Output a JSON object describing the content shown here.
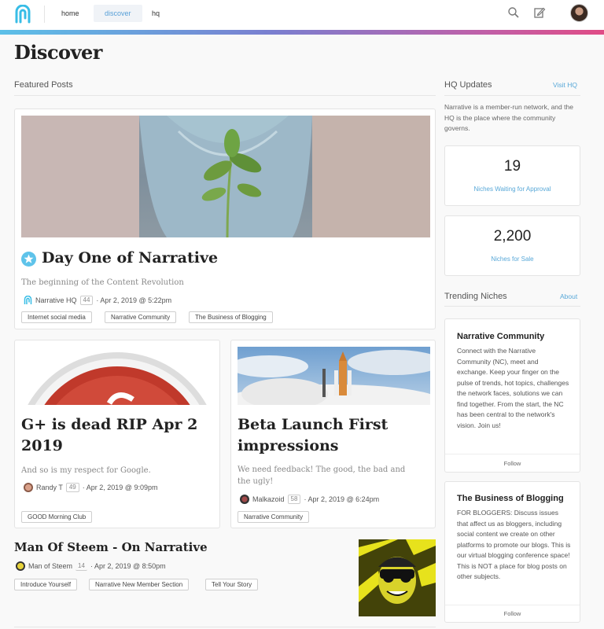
{
  "nav": {
    "home": "home",
    "discover": "discover",
    "hq": "hq"
  },
  "page": {
    "title": "Discover"
  },
  "featured": {
    "label": "Featured Posts",
    "main": {
      "title": "Day One of Narrative",
      "subtitle": "The beginning of the Content Revolution",
      "author": "Narrative HQ",
      "rep": "44",
      "date": "· Apr 2, 2019 @ 5:22pm",
      "tags": [
        "Internet social media",
        "Narrative Community",
        "The Business of Blogging"
      ]
    },
    "left": {
      "title": "G+ is dead RIP Apr 2 2019",
      "subtitle": "And so is my respect for Google.",
      "author": "Randy T",
      "rep": "49",
      "date": "· Apr 2, 2019 @ 9:09pm",
      "tags": [
        "GOOD Morning Club"
      ]
    },
    "right": {
      "title": "Beta Launch First impressions",
      "subtitle": "We need feedback! The good, the bad and the ugly!",
      "author": "Malkazoid",
      "rep": "58",
      "date": "· Apr 2, 2019 @ 6:24pm",
      "tags": [
        "Narrative Community"
      ]
    }
  },
  "list_post": {
    "title": "Man Of Steem - On Narrative",
    "author": "Man of Steem",
    "rep": "14",
    "date": "· Apr 2, 2019 @ 8:50pm",
    "tags": [
      "Introduce Yourself",
      "Narrative New Member Section",
      "Tell Your Story"
    ]
  },
  "hq": {
    "label": "HQ Updates",
    "link": "Visit HQ",
    "desc": "Narrative is a member-run network, and the HQ is the place where the community governs.",
    "stats": [
      {
        "value": "19",
        "label": "Niches Waiting for Approval"
      },
      {
        "value": "2,200",
        "label": "Niches for Sale"
      }
    ]
  },
  "trending": {
    "label": "Trending Niches",
    "link": "About",
    "niches": [
      {
        "title": "Narrative Community",
        "desc": "Connect with the Narrative Community (NC), meet and exchange. Keep your finger on the pulse of trends, hot topics, challenges the network faces, solutions we can find together. From the start, the NC has been central to the network's vision. Join us!",
        "follow": "Follow"
      },
      {
        "title": "The Business of Blogging",
        "desc": "FOR BLOGGERS: Discuss issues that affect us as bloggers, including social content we create on other platforms to promote our blogs. This is our virtual blogging conference space! This is NOT a place for blog posts on other subjects.",
        "follow": "Follow"
      }
    ]
  },
  "colors": {
    "accent": "#58a8d8",
    "gradient": [
      "#5cc0e8",
      "#7a7fd0",
      "#c060a8",
      "#e04c86"
    ]
  }
}
